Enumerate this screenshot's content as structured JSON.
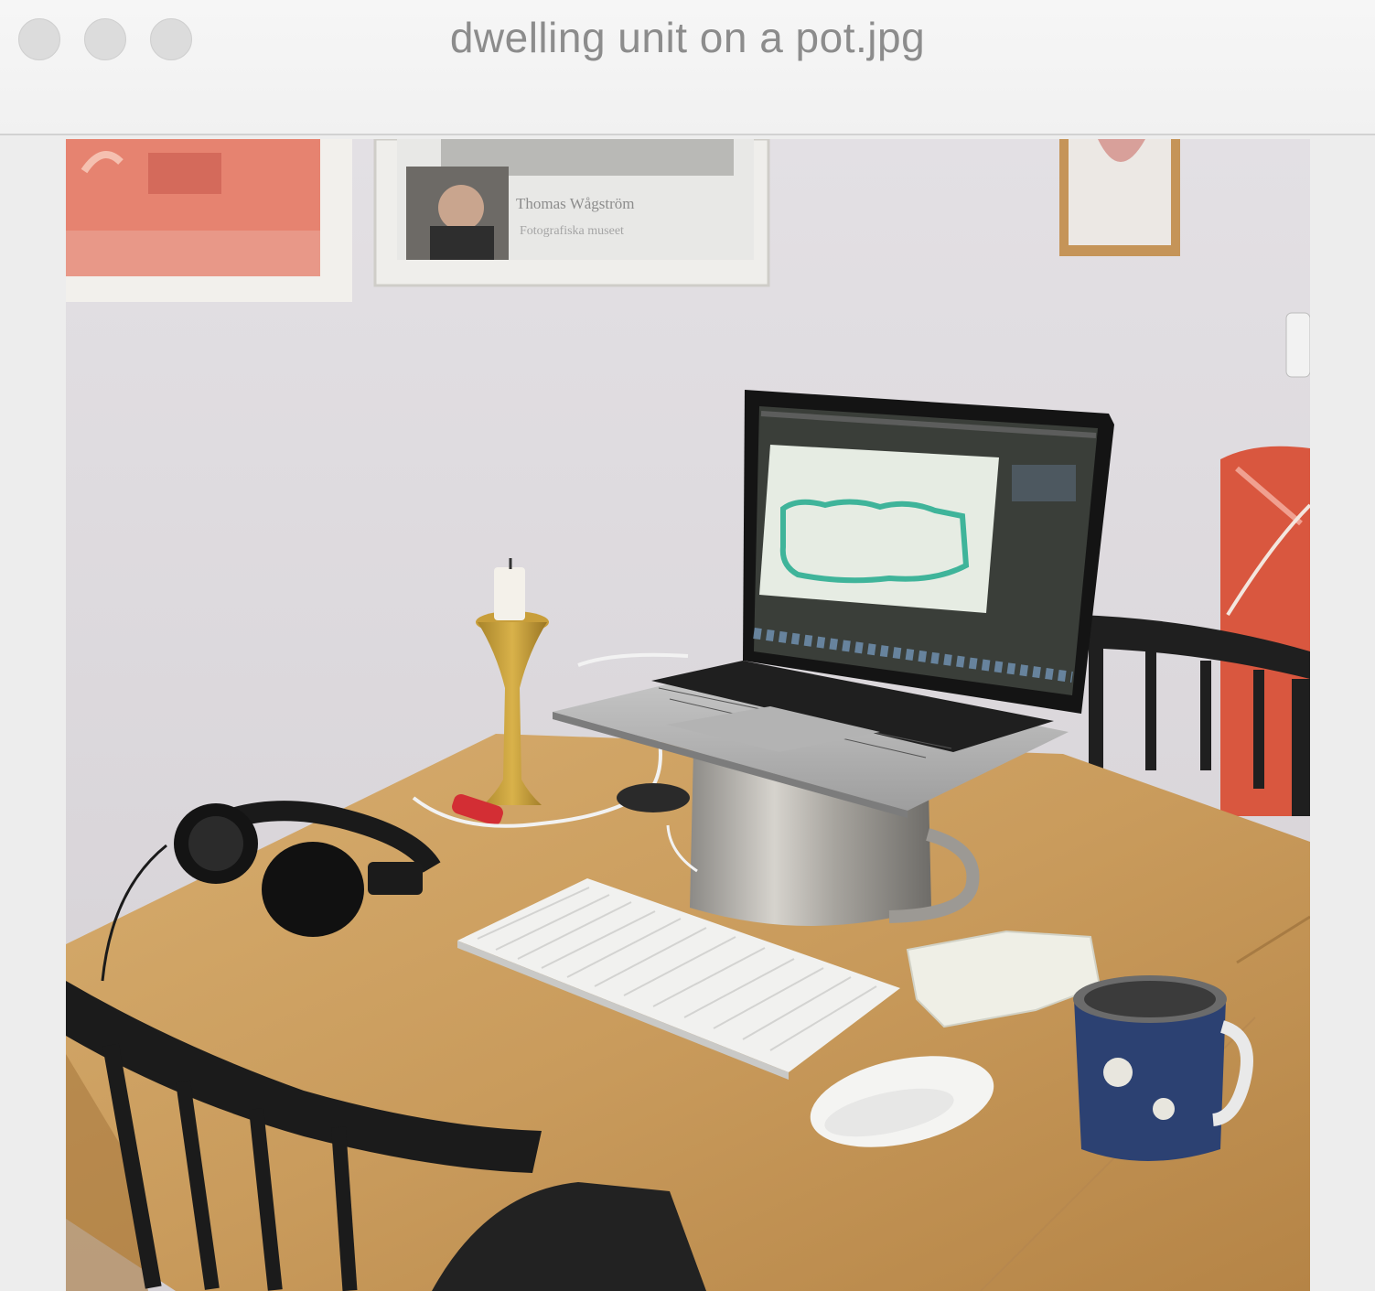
{
  "window": {
    "title": "dwelling unit on a pot.jpg",
    "buttons": [
      "close",
      "minimize",
      "zoom"
    ]
  },
  "photo": {
    "poster_text_line1": "Thomas Wågström",
    "poster_text_line2": "Fotografiska museet",
    "colors": {
      "wall": "#dedbe0",
      "table": "#c79a5a",
      "chair": "#1c1c1c",
      "screen_accent": "#3fb49a",
      "armchair": "#d9573f"
    },
    "icons": [
      "laptop-icon",
      "keyboard-icon",
      "mouse-icon",
      "headphones-icon",
      "mug-icon",
      "candle-icon",
      "pot-icon"
    ]
  }
}
